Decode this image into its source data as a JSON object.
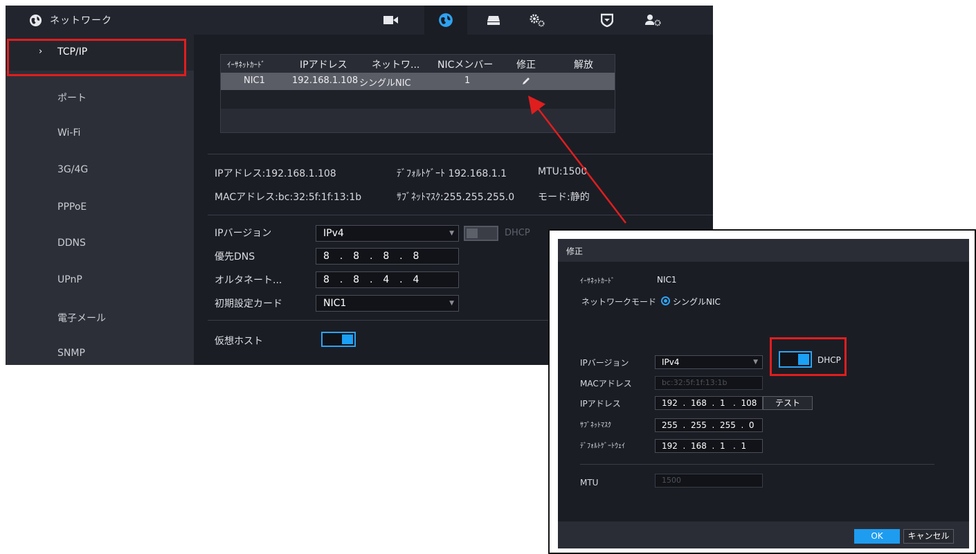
{
  "window": {
    "title": "ネットワーク"
  },
  "topnav": {
    "icons": [
      "camera-icon",
      "network-globe-icon",
      "storage-hdd-icon",
      "system-gears-icon",
      "security-shield-icon",
      "account-user-icon"
    ],
    "active": "network-globe-icon"
  },
  "sidebar": {
    "items": [
      {
        "label": "TCP/IP",
        "active": true
      },
      {
        "label": "ポート"
      },
      {
        "label": "Wi-Fi"
      },
      {
        "label": "3G/4G"
      },
      {
        "label": "PPPoE"
      },
      {
        "label": "DDNS"
      },
      {
        "label": "UPnP"
      },
      {
        "label": "電子メール"
      },
      {
        "label": "SNMP"
      }
    ]
  },
  "nic_table": {
    "headers": [
      "ｲｰｻﾈｯﾄｶｰﾄﾞ",
      "IPアドレス",
      "ネットワ...",
      "NICメンバー",
      "修正",
      "解放"
    ],
    "rows": [
      {
        "card": "NIC1",
        "ip": "192.168.1.108",
        "mode": "シングルNIC",
        "members": "1"
      }
    ]
  },
  "info": {
    "ip": "IPアドレス:192.168.1.108",
    "gateway": "ﾃﾞﾌｫﾙﾄｹﾞｰﾄ 192.168.1.1",
    "mtu": "MTU:1500",
    "mac": "MACアドレス:bc:32:5f:1f:13:1b",
    "subnet": "ｻﾌﾞﾈｯﾄﾏｽｸ:255.255.255.0",
    "mode": "モード:静的"
  },
  "form": {
    "ip_version_label": "IPバージョン",
    "ip_version_value": "IPv4",
    "dhcp_label": "DHCP",
    "dns_pref_label": "優先DNS",
    "dns_pref_value": "8  .  8  .  8  .  8",
    "dns_alt_label": "オルタネート...",
    "dns_alt_value": "8  .  8  .  4  .  4",
    "default_card_label": "初期設定カード",
    "default_card_value": "NIC1",
    "virtual_host_label": "仮想ホスト"
  },
  "dialog": {
    "title": "修正",
    "card_label": "ｲｰｻﾈｯﾄｶｰﾄﾞ",
    "card_value": "NIC1",
    "netmode_label": "ネットワークモード",
    "netmode_value": "シングルNIC",
    "ipver_label": "IPバージョン",
    "ipver_value": "IPv4",
    "dhcp_label": "DHCP",
    "mac_label": "MACアドレス",
    "mac_value": "bc:32:5f:1f:13:1b",
    "ip_label": "IPアドレス",
    "ip_value": "192  .  168  .  1   .  108",
    "test_label": "テスト",
    "subnet_label": "ｻﾌﾞﾈｯﾄﾏｽｸ",
    "subnet_value": "255  .  255  .  255  .  0",
    "gateway_label": "ﾃﾞﾌｫﾙﾄｹﾞｰﾄｳｪｲ",
    "gateway_value": "192  .  168  .  1   .  1",
    "mtu_label": "MTU",
    "mtu_value": "1500",
    "ok_label": "OK",
    "cancel_label": "キャンセル"
  },
  "colors": {
    "accent": "#1e9cf0",
    "highlight": "#e01e1e",
    "background": "#1b1d25",
    "sidebar": "#2d2f38"
  }
}
